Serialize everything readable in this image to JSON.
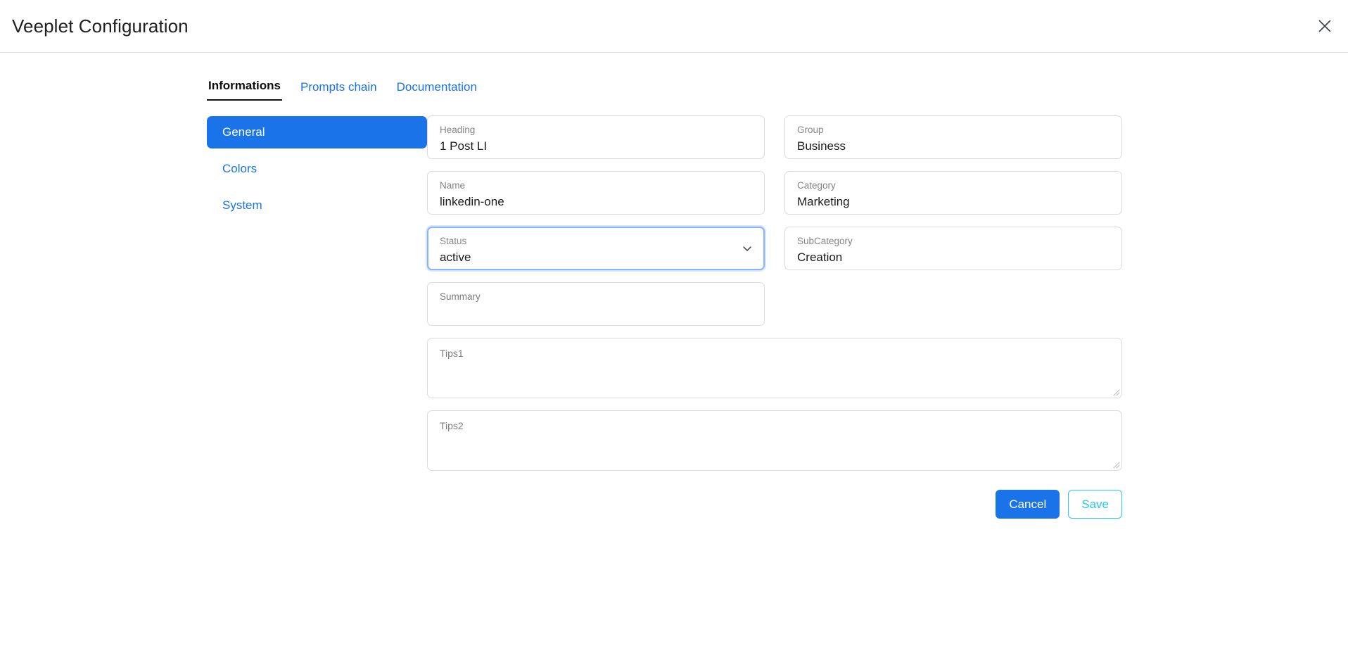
{
  "window": {
    "title": "Veeplet Configuration",
    "close_icon": "close-icon"
  },
  "tabs": [
    {
      "label": "Informations",
      "active": true
    },
    {
      "label": "Prompts chain",
      "active": false
    },
    {
      "label": "Documentation",
      "active": false
    }
  ],
  "sidebar": {
    "items": [
      {
        "label": "General",
        "active": true
      },
      {
        "label": "Colors",
        "active": false
      },
      {
        "label": "System",
        "active": false
      }
    ]
  },
  "form": {
    "fields": {
      "heading": {
        "label": "Heading",
        "value": "1 Post LI"
      },
      "group": {
        "label": "Group",
        "value": "Business"
      },
      "name": {
        "label": "Name",
        "value": "linkedin-one"
      },
      "category": {
        "label": "Category",
        "value": "Marketing"
      },
      "status": {
        "label": "Status",
        "value": "active",
        "focused": true,
        "icon": "chevron-down-icon"
      },
      "subcategory": {
        "label": "SubCategory",
        "value": "Creation"
      },
      "summary": {
        "label": "Summary",
        "value": ""
      },
      "tips1": {
        "label": "Tips1",
        "value": ""
      },
      "tips2": {
        "label": "Tips2",
        "value": ""
      }
    }
  },
  "actions": {
    "cancel_label": "Cancel",
    "save_label": "Save"
  },
  "colors": {
    "accent_blue": "#1a73e8",
    "save_cyan": "#28c8f0",
    "focus_ring": "#8ab4f8",
    "label_grey": "#848484",
    "border_grey": "#dcdcdc"
  }
}
